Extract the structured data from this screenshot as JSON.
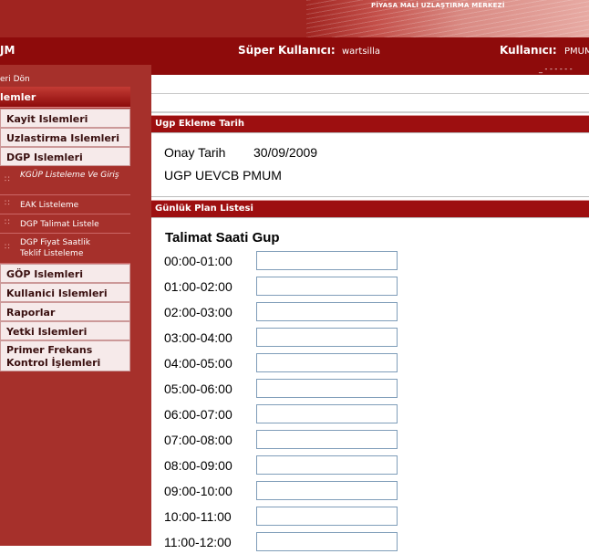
{
  "banner": {
    "brand_text": "PİYASA MALİ UZLAŞTIRMA MERKEZİ"
  },
  "topbar": {
    "system_name": "JM",
    "super_user_label": "Süper Kullanıcı:",
    "super_user_value": "wartsilla",
    "user_label": "Kullanıcı:",
    "user_value": "PMUM",
    "sub_stub": "_ - - - - - -"
  },
  "sidebar": {
    "back_link": "eri Dön",
    "header": "lemler",
    "items": [
      {
        "label": "Kayit Islemleri"
      },
      {
        "label": "Uzlastirma Islemleri"
      },
      {
        "label": "DGP Islemleri"
      }
    ],
    "subitems": [
      {
        "label": "KGÜP Listeleme Ve Giriş"
      },
      {
        "label": "EAK Listeleme"
      },
      {
        "label": "DGP Talimat Listele"
      },
      {
        "label": "DGP Fiyat Saatlik Teklif Listeleme"
      }
    ],
    "items_after": [
      {
        "label": "GÖP Islemleri"
      },
      {
        "label": "Kullanici Islemleri"
      },
      {
        "label": "Raporlar"
      },
      {
        "label": "Yetki Islemleri"
      },
      {
        "label": "Primer Frekans Kontrol İşlemleri"
      }
    ],
    "accent_color": "#a6302b"
  },
  "main": {
    "section1_title": "Ugp Ekleme Tarih",
    "onay_label": "Onay Tarih",
    "onay_value": "30/09/2009",
    "ugp_line": "UGP UEVCB PMUM",
    "section2_title": "Günlük Plan Listesi",
    "column_title": "Talimat Saati Gup",
    "hours": [
      {
        "label": "00:00-01:00",
        "value": ""
      },
      {
        "label": "01:00-02:00",
        "value": ""
      },
      {
        "label": "02:00-03:00",
        "value": ""
      },
      {
        "label": "03:00-04:00",
        "value": ""
      },
      {
        "label": "04:00-05:00",
        "value": ""
      },
      {
        "label": "05:00-06:00",
        "value": ""
      },
      {
        "label": "06:00-07:00",
        "value": ""
      },
      {
        "label": "07:00-08:00",
        "value": ""
      },
      {
        "label": "08:00-09:00",
        "value": ""
      },
      {
        "label": "09:00-10:00",
        "value": ""
      },
      {
        "label": "10:00-11:00",
        "value": ""
      },
      {
        "label": "11:00-12:00",
        "value": ""
      }
    ]
  },
  "colors": {
    "brand_red": "#8e0b0b",
    "section_bar": "#9d0f10"
  }
}
